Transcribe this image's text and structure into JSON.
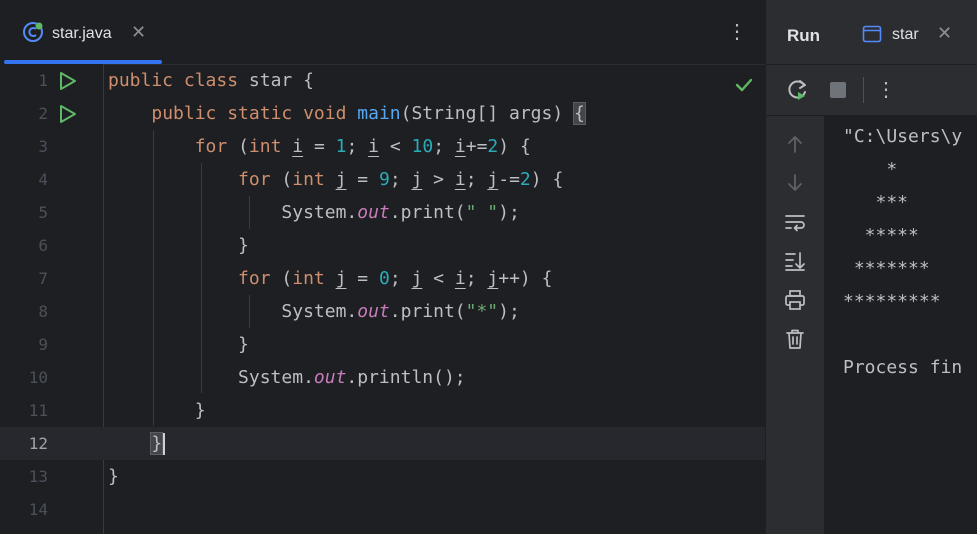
{
  "editor": {
    "tab": {
      "label": "star.java",
      "close": "✕"
    },
    "menu_icon": "⋮",
    "lines": [
      {
        "num": "1",
        "run": true,
        "tokens": [
          {
            "t": "public ",
            "c": "kw"
          },
          {
            "t": "class ",
            "c": "kw"
          },
          {
            "t": "star {"
          }
        ]
      },
      {
        "num": "2",
        "run": true,
        "tokens": [
          {
            "t": "    "
          },
          {
            "t": "public ",
            "c": "kw"
          },
          {
            "t": "static ",
            "c": "kw"
          },
          {
            "t": "void ",
            "c": "kw"
          },
          {
            "t": "main",
            "c": "fn"
          },
          {
            "t": "(String[] args) "
          },
          {
            "t": "{",
            "c": "brace-hl"
          }
        ]
      },
      {
        "num": "3",
        "tokens": [
          {
            "t": "        "
          },
          {
            "t": "for ",
            "c": "kw"
          },
          {
            "t": "("
          },
          {
            "t": "int ",
            "c": "kw"
          },
          {
            "t": "i",
            "c": "var"
          },
          {
            "t": " = "
          },
          {
            "t": "1",
            "c": "num"
          },
          {
            "t": "; "
          },
          {
            "t": "i",
            "c": "var"
          },
          {
            "t": " < "
          },
          {
            "t": "10",
            "c": "num"
          },
          {
            "t": "; "
          },
          {
            "t": "i",
            "c": "var"
          },
          {
            "t": "+="
          },
          {
            "t": "2",
            "c": "num"
          },
          {
            "t": ") {"
          }
        ]
      },
      {
        "num": "4",
        "tokens": [
          {
            "t": "            "
          },
          {
            "t": "for ",
            "c": "kw"
          },
          {
            "t": "("
          },
          {
            "t": "int ",
            "c": "kw"
          },
          {
            "t": "j",
            "c": "var"
          },
          {
            "t": " = "
          },
          {
            "t": "9",
            "c": "num"
          },
          {
            "t": "; "
          },
          {
            "t": "j",
            "c": "var"
          },
          {
            "t": " > "
          },
          {
            "t": "i",
            "c": "var"
          },
          {
            "t": "; "
          },
          {
            "t": "j",
            "c": "var"
          },
          {
            "t": "-="
          },
          {
            "t": "2",
            "c": "num"
          },
          {
            "t": ") {"
          }
        ]
      },
      {
        "num": "5",
        "tokens": [
          {
            "t": "                System."
          },
          {
            "t": "out",
            "c": "fld"
          },
          {
            "t": ".print("
          },
          {
            "t": "\" \"",
            "c": "str"
          },
          {
            "t": ");"
          }
        ]
      },
      {
        "num": "6",
        "tokens": [
          {
            "t": "            }"
          }
        ]
      },
      {
        "num": "7",
        "tokens": [
          {
            "t": "            "
          },
          {
            "t": "for ",
            "c": "kw"
          },
          {
            "t": "("
          },
          {
            "t": "int ",
            "c": "kw"
          },
          {
            "t": "j",
            "c": "var"
          },
          {
            "t": " = "
          },
          {
            "t": "0",
            "c": "num"
          },
          {
            "t": "; "
          },
          {
            "t": "j",
            "c": "var"
          },
          {
            "t": " < "
          },
          {
            "t": "i",
            "c": "var"
          },
          {
            "t": "; "
          },
          {
            "t": "j",
            "c": "var"
          },
          {
            "t": "++) {"
          }
        ]
      },
      {
        "num": "8",
        "tokens": [
          {
            "t": "                System."
          },
          {
            "t": "out",
            "c": "fld"
          },
          {
            "t": ".print("
          },
          {
            "t": "\"*\"",
            "c": "str"
          },
          {
            "t": ");"
          }
        ]
      },
      {
        "num": "9",
        "tokens": [
          {
            "t": "            }"
          }
        ]
      },
      {
        "num": "10",
        "tokens": [
          {
            "t": "            System."
          },
          {
            "t": "out",
            "c": "fld"
          },
          {
            "t": ".println();"
          }
        ]
      },
      {
        "num": "11",
        "tokens": [
          {
            "t": "        }"
          }
        ]
      },
      {
        "num": "12",
        "current": true,
        "tokens": [
          {
            "t": "    "
          },
          {
            "t": "}",
            "c": "brace-hl"
          },
          {
            "t": "",
            "c": "caret"
          }
        ]
      },
      {
        "num": "13",
        "tokens": [
          {
            "t": "}"
          }
        ]
      },
      {
        "num": "14",
        "tokens": []
      }
    ]
  },
  "run_panel": {
    "title": "Run",
    "tab_label": "star",
    "tab_close": "✕",
    "menu_icon": "⋮",
    "console_lines": [
      "\"C:\\Users\\y",
      "    *",
      "   ***",
      "  *****",
      " *******",
      "*********",
      "",
      "Process fin"
    ]
  },
  "colors": {
    "accent": "#3574f0",
    "run_green": "#5fb865",
    "keyword": "#cf8e6d",
    "function": "#56a8f5",
    "number": "#2aacb8",
    "string": "#6aab73",
    "field": "#c77dbb"
  }
}
